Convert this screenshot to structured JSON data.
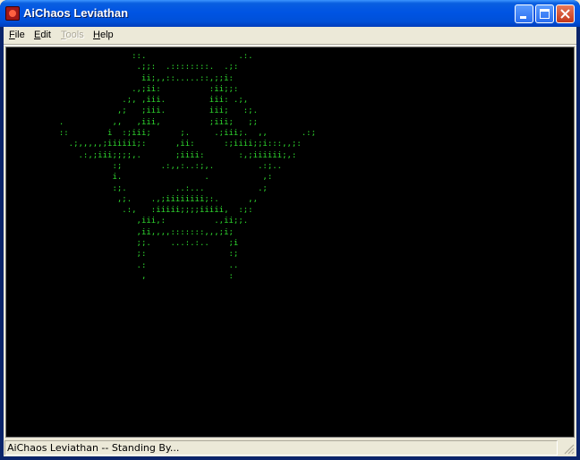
{
  "window": {
    "title": "AiChaos Leviathan"
  },
  "menu": [
    {
      "label_pre": "",
      "label_ul": "F",
      "label_post": "ile",
      "enabled": true
    },
    {
      "label_pre": "",
      "label_ul": "E",
      "label_post": "dit",
      "enabled": true
    },
    {
      "label_pre": "",
      "label_ul": "T",
      "label_post": "ools",
      "enabled": false
    },
    {
      "label_pre": "",
      "label_ul": "H",
      "label_post": "elp",
      "enabled": true
    }
  ],
  "ascii_art": "                 ::.                   .:.\n                  .;;:  .::::::::.  .;:\n                   ii;,,::.....::,;;i:\n                 .,;ii:          :ii;;:\n               .;, ,iii.         iii: .;,\n              ,;   ;iii.         iii;   :;.\n  .          ,,   ,iii,          ;iii;   ;;\n  ::        i  :;iii;      ;.     .;iii;.  ,,       .:;\n    .;,,,,,;iiiiii;:      ,ii:      :;iiii;;i:::,,;:\n      .:,;iii;;;;,.       ;iiii:       :,;iiiiii;,:\n             :;        .:,,:..:;,.         .:;..\n             i.                 .           ,:\n             :;.          ..:...           .;\n              ,;.    .,;iiiiiiii;:.      ,,\n               .:,   :iiiii;;;;iiiii,  :;:\n                  ,iii,:          .,ii;;.\n                  ,ii,,,,:::::::,,,;i;\n                  ;;.    ...:.:..    ;i\n                  ;:                 :;\n                  .:                 ..\n                   ,                 :",
  "status": {
    "text": "AiChaos Leviathan -- Standing By..."
  },
  "colors": {
    "ascii": "#2fd82f",
    "display_bg": "#000000",
    "titlebar": "#0054e3"
  },
  "icons": [
    "app-icon",
    "minimize-icon",
    "maximize-icon",
    "close-icon",
    "resize-grip-icon"
  ]
}
